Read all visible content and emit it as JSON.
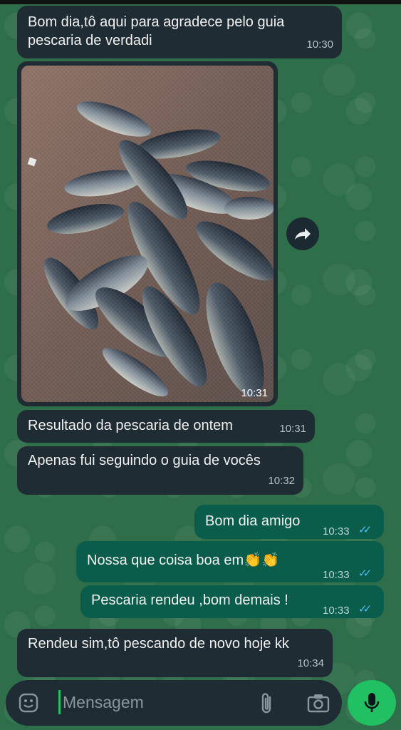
{
  "messages": [
    {
      "direction": "in",
      "text_line1": "Bom dia,tô aqui para agradece pelo guia",
      "text_line2": "pescaria de verdadi",
      "time": "10:30"
    },
    {
      "direction": "in",
      "type": "image",
      "time": "10:31",
      "image_alt": "fish-pile-photo"
    },
    {
      "direction": "in",
      "text": "Resultado da pescaria de ontem",
      "time": "10:31"
    },
    {
      "direction": "in",
      "text": "Apenas fui seguindo o guia de vocês",
      "time": "10:32"
    },
    {
      "direction": "out",
      "text": "Bom dia amigo",
      "time": "10:33",
      "status": "read"
    },
    {
      "direction": "out",
      "text": "Nossa que coisa boa em👏👏",
      "time": "10:33",
      "status": "read"
    },
    {
      "direction": "out",
      "text": "Pescaria rendeu ,bom demais !",
      "time": "10:33",
      "status": "read"
    },
    {
      "direction": "in",
      "text": "Rendeu sim,tô pescando de novo hoje kk",
      "time": "10:34"
    }
  ],
  "composer": {
    "placeholder": "Mensagem"
  },
  "colors": {
    "background": "#2f6e4a",
    "incoming": "#1f2c33",
    "outgoing": "#0a5c4b",
    "accent": "#21c063",
    "read_ticks": "#53bdeb"
  },
  "icons": [
    "forward-icon",
    "emoji-icon",
    "attach-icon",
    "camera-icon",
    "mic-icon"
  ]
}
